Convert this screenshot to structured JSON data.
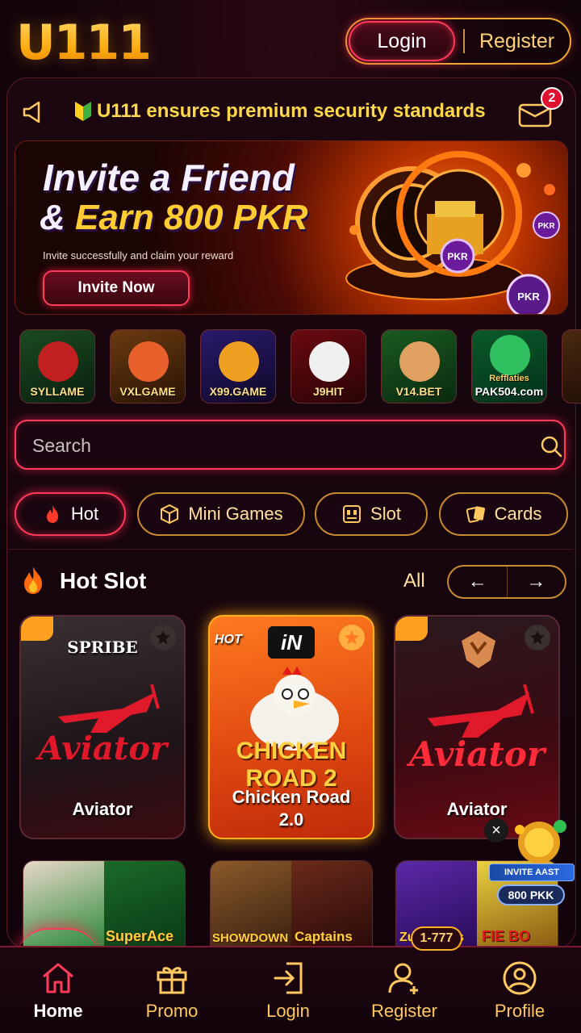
{
  "brand": {
    "logo": "U111"
  },
  "auth": {
    "login_label": "Login",
    "register_label": "Register"
  },
  "notice": {
    "text": "U111 ensures premium security standards",
    "mail_badge": "2"
  },
  "banner": {
    "title_line1": "Invite a Friend",
    "title_amp": "& ",
    "title_earn": "Earn 800 PKR",
    "subtitle": "Invite successfully and claim your reward",
    "button": "Invite Now",
    "coin_labels": [
      "PKR",
      "PKR",
      "PKR"
    ]
  },
  "partners": [
    {
      "label": "SYLLAME"
    },
    {
      "label": "VXLGAME"
    },
    {
      "label": "X99.GAME"
    },
    {
      "label": "J9HIT"
    },
    {
      "label": "V14.BET"
    },
    {
      "label": "PAK504.com",
      "sub": "Refflaties"
    }
  ],
  "search": {
    "placeholder": "Search"
  },
  "categories": [
    {
      "label": "Hot",
      "icon": "flame-icon",
      "active": true
    },
    {
      "label": "Mini Games",
      "icon": "cube-icon",
      "active": false
    },
    {
      "label": "Slot",
      "icon": "slot-machine-icon",
      "active": false
    },
    {
      "label": "Cards",
      "icon": "cards-icon",
      "active": false
    }
  ],
  "section": {
    "title": "Hot Slot",
    "all_label": "All",
    "prev": "←",
    "next": "→"
  },
  "games": [
    {
      "name": "Aviator",
      "provider": "SPRIBE",
      "logo_text": "Aviator"
    },
    {
      "name": "Chicken Road 2.0",
      "provider": "iN",
      "tag": "HOT",
      "logo_text": "CHICKEN ROAD 2"
    },
    {
      "name": "Aviator",
      "logo_text": "Aviator"
    }
  ],
  "row2": [
    {
      "left": "",
      "right": "SuperAce"
    },
    {
      "left": "SHOWDOWN",
      "right": "Captains"
    },
    {
      "left": "Zup Zdays",
      "right": "FIE BO"
    }
  ],
  "float_invite": {
    "ribbon": "INVITE AAST",
    "amount": "800 PKK",
    "close": "×"
  },
  "nav": [
    {
      "label": "Home",
      "icon": "home-icon",
      "active": true
    },
    {
      "label": "Promo",
      "icon": "gift-icon"
    },
    {
      "label": "Login",
      "icon": "login-icon"
    },
    {
      "label": "Register",
      "icon": "add-user-icon",
      "badge": "1-777"
    },
    {
      "label": "Profile",
      "icon": "profile-icon"
    }
  ],
  "colors": {
    "accent": "#ff3a5a",
    "gold": "#ffc860",
    "background": "#12050a"
  }
}
